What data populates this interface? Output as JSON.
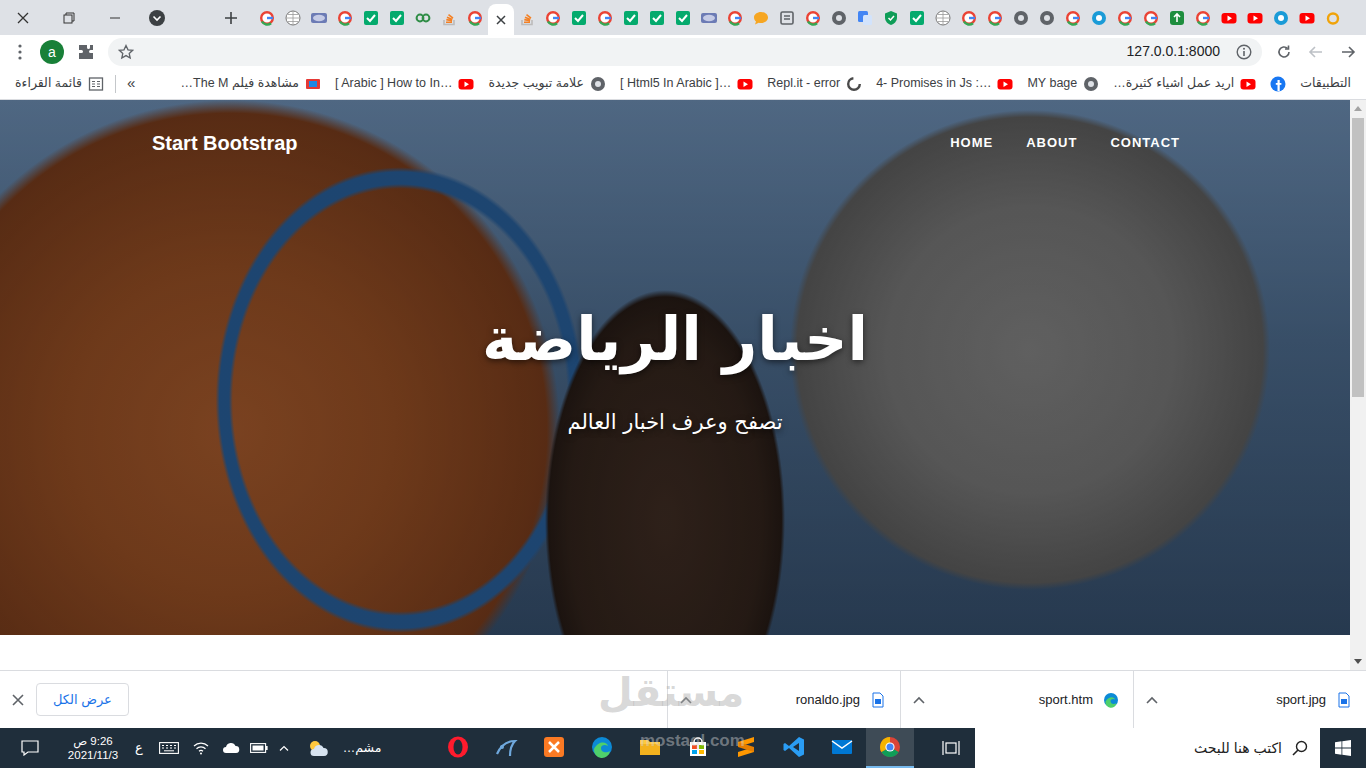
{
  "browser": {
    "tabs": [
      {
        "kind": "google",
        "selected": false
      },
      {
        "kind": "wiki",
        "selected": false
      },
      {
        "kind": "php",
        "selected": false
      },
      {
        "kind": "google",
        "selected": false
      },
      {
        "kind": "w3",
        "selected": false
      },
      {
        "kind": "w3",
        "selected": false
      },
      {
        "kind": "gfg",
        "selected": false
      },
      {
        "kind": "so",
        "selected": false
      },
      {
        "kind": "google",
        "selected": false
      },
      {
        "selected": true
      },
      {
        "kind": "so",
        "selected": false
      },
      {
        "kind": "google",
        "selected": false
      },
      {
        "kind": "w3",
        "selected": false
      },
      {
        "kind": "google",
        "selected": false
      },
      {
        "kind": "w3",
        "selected": false
      },
      {
        "kind": "w3",
        "selected": false
      },
      {
        "kind": "w3",
        "selected": false
      },
      {
        "kind": "php",
        "selected": false
      },
      {
        "kind": "google",
        "selected": false
      },
      {
        "kind": "chat",
        "selected": false
      },
      {
        "kind": "book",
        "selected": false
      },
      {
        "kind": "google",
        "selected": false
      },
      {
        "kind": "globe",
        "selected": false
      },
      {
        "kind": "translate",
        "selected": false
      },
      {
        "kind": "shield",
        "selected": false
      },
      {
        "kind": "w3",
        "selected": false
      },
      {
        "kind": "wiki",
        "selected": false
      },
      {
        "kind": "google",
        "selected": false
      },
      {
        "kind": "google",
        "selected": false
      },
      {
        "kind": "globe",
        "selected": false
      },
      {
        "kind": "globe",
        "selected": false
      },
      {
        "kind": "google",
        "selected": false
      },
      {
        "kind": "blue",
        "selected": false
      },
      {
        "kind": "google",
        "selected": false
      },
      {
        "kind": "google",
        "selected": false
      },
      {
        "kind": "green",
        "selected": false
      },
      {
        "kind": "google",
        "selected": false
      },
      {
        "kind": "youtube",
        "selected": false
      },
      {
        "kind": "youtube",
        "selected": false
      },
      {
        "kind": "blue",
        "selected": false
      },
      {
        "kind": "youtube",
        "selected": false
      },
      {
        "kind": "mostaql",
        "selected": false
      }
    ],
    "profile": "a",
    "address": "127.0.0.1:8000",
    "bookmarks": [
      {
        "kind": "text",
        "label": "التطبيقات"
      },
      {
        "kind": "facebook"
      },
      {
        "kind": "youtube",
        "label": "اريد عمل اشياء كثيرة…"
      },
      {
        "kind": "globe",
        "label": "MY bage"
      },
      {
        "kind": "youtube",
        "label": "4- Promises in Js :…"
      },
      {
        "kind": "recaptcha",
        "label": "Repl.it - error"
      },
      {
        "kind": "youtube",
        "label": "[ Html5 In Arabic ]…"
      },
      {
        "kind": "globe",
        "label": "علامة تبويب جديدة"
      },
      {
        "kind": "youtube",
        "label": "[ Arabic ] How to In…"
      },
      {
        "kind": "film",
        "label": "مشاهدة فيلم The M…"
      }
    ],
    "more_bookmarks": "»",
    "reading_list": "قائمة القراءة"
  },
  "page": {
    "brand": "Start Bootstrap",
    "nav": [
      "HOME",
      "ABOUT",
      "CONTACT"
    ],
    "heading": "اخبار الرياضة",
    "subheading": "تصفح وعرف اخبار العالم",
    "scroll": {
      "level": 0.52
    }
  },
  "downloads": {
    "items": [
      {
        "name": "sport.jpg",
        "kind": "image"
      },
      {
        "name": "sport.htm",
        "kind": "edge"
      },
      {
        "name": "ronaldo.jpg",
        "kind": "image"
      }
    ],
    "show_all": "عرض الكل"
  },
  "taskbar": {
    "search_placeholder": "اكتب هنا للبحث",
    "apps": [
      {
        "kind": "opera",
        "selected": false
      },
      {
        "kind": "workbench",
        "selected": false
      },
      {
        "kind": "xampp",
        "selected": false
      },
      {
        "kind": "edge",
        "selected": false
      },
      {
        "kind": "explorer",
        "selected": false
      },
      {
        "kind": "store",
        "selected": false
      },
      {
        "kind": "sublime",
        "selected": false
      },
      {
        "kind": "vscode",
        "selected": false
      },
      {
        "kind": "mail",
        "selected": false
      },
      {
        "kind": "chrome",
        "selected": true
      }
    ],
    "weather": "مشم…",
    "language": "ع",
    "time": "9:26 ص",
    "date": "2021/11/3"
  },
  "watermark": {
    "name": "مستقل",
    "site": "mostaql.com"
  }
}
